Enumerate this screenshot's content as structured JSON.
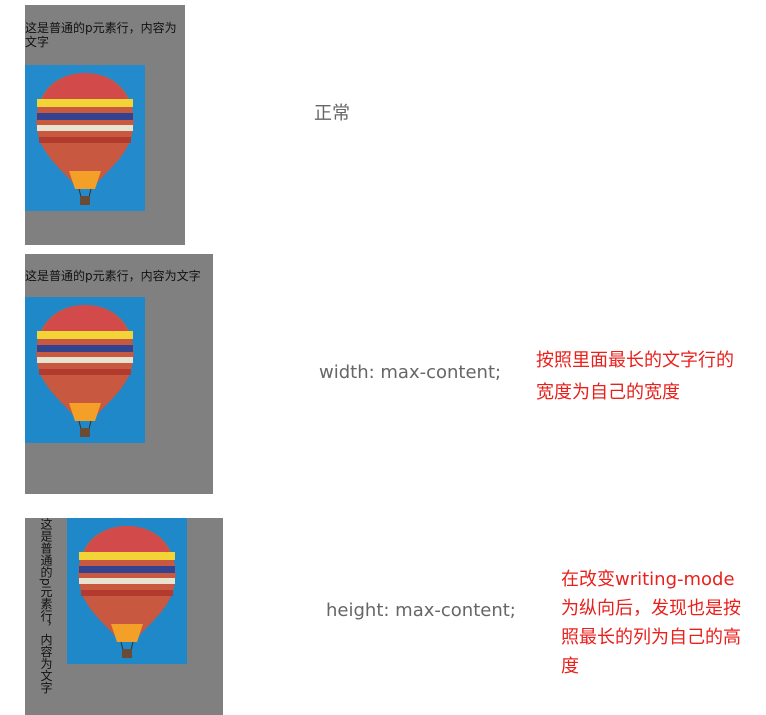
{
  "paragraph_text": "这是普通的p元素行，内容为文字",
  "demos": [
    {
      "label": "正常",
      "note": []
    },
    {
      "label": "width: max-content;",
      "note": [
        "按照里面最长的文字行的",
        "宽度为自己的宽度"
      ]
    },
    {
      "label": "height: max-content;",
      "note": [
        "在改变writing-mode",
        "为纵向后，发现也是按",
        "照最长的列为自己的高",
        "度"
      ]
    }
  ],
  "colors": {
    "box": "#808080",
    "label": "#666666",
    "note": "#e8211d",
    "sky": "#1f88c8"
  },
  "image_icon": "hot-air-balloon"
}
